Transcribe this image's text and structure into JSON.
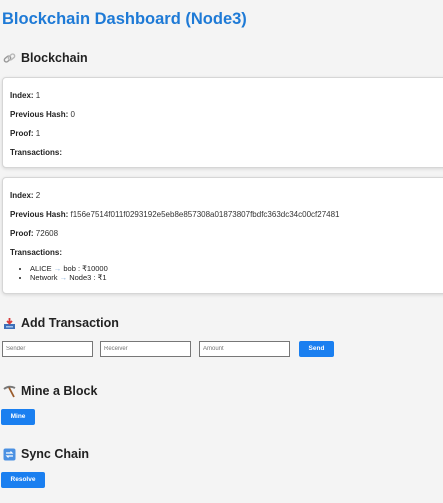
{
  "page_title": "Blockchain Dashboard (Node3)",
  "colors": {
    "accent": "#1e7ad6",
    "button": "#1a7ff0"
  },
  "blockchain": {
    "heading": "Blockchain",
    "icon": "link-icon",
    "blocks": [
      {
        "index_label": "Index:",
        "index": "1",
        "prev_label": "Previous Hash:",
        "prev": "0",
        "proof_label": "Proof:",
        "proof": "1",
        "tx_label": "Transactions:",
        "transactions": []
      },
      {
        "index_label": "Index:",
        "index": "2",
        "prev_label": "Previous Hash:",
        "prev": "f156e7514f011f0293192e5eb8e857308a01873807fbdfc363dc34c00cf27481",
        "proof_label": "Proof:",
        "proof": "72608",
        "tx_label": "Transactions:",
        "transactions": [
          {
            "sender": "ALICE",
            "arrow": "→",
            "receiver": "bob",
            "amount": ": ₹10000"
          },
          {
            "sender": "Network",
            "arrow": "→",
            "receiver": "Node3",
            "amount": ": ₹1"
          }
        ]
      }
    ]
  },
  "add_transaction": {
    "heading": "Add Transaction",
    "icon": "inbox-tray-icon",
    "sender_placeholder": "Sender",
    "receiver_placeholder": "Receiver",
    "amount_placeholder": "Amount",
    "send_label": "Send"
  },
  "mine": {
    "heading": "Mine a Block",
    "icon": "pickaxe-icon",
    "button_label": "Mine"
  },
  "sync": {
    "heading": "Sync Chain",
    "icon": "sync-arrows-icon",
    "button_label": "Resolve"
  }
}
